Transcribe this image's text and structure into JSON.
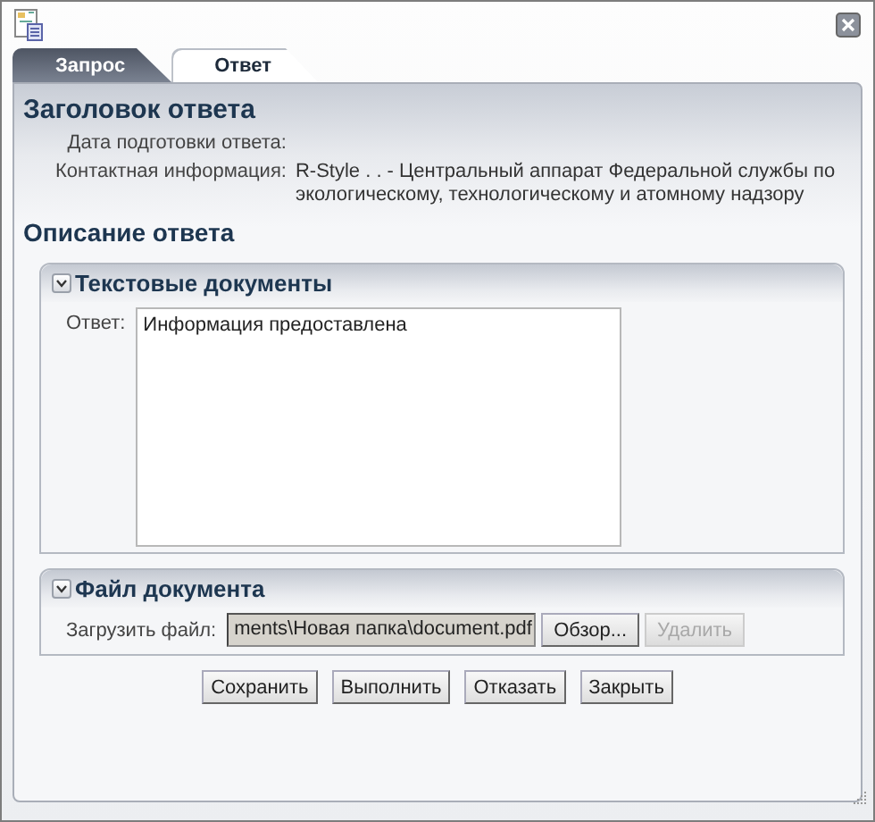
{
  "tabs": [
    {
      "label": "Запрос",
      "selected": false
    },
    {
      "label": "Ответ",
      "selected": true
    }
  ],
  "header": {
    "title": "Заголовок ответа",
    "fields": [
      {
        "label": "Дата подготовки ответа:"
      },
      {
        "label": "Контактная информация:",
        "value": "R-Style . . - Центральный аппарат Федеральной службы по экологическому, технологическому и атомному надзору"
      }
    ]
  },
  "description": {
    "title": "Описание ответа",
    "sections": [
      {
        "kind": "text",
        "title": "Текстовые документы",
        "expanded": true,
        "label": "Ответ:",
        "value": "Информация предоставлена"
      },
      {
        "kind": "file",
        "title": "Файл документа",
        "expanded": true,
        "label": "Загрузить файл:",
        "value": "ments\\Новая папка\\document.pdf",
        "buttons": [
          {
            "label": "Обзор...",
            "disabled": false
          },
          {
            "label": "Удалить",
            "disabled": true
          }
        ]
      }
    ]
  },
  "buttons": [
    "Сохранить",
    "Выполнить",
    "Отказать",
    "Закрыть"
  ]
}
